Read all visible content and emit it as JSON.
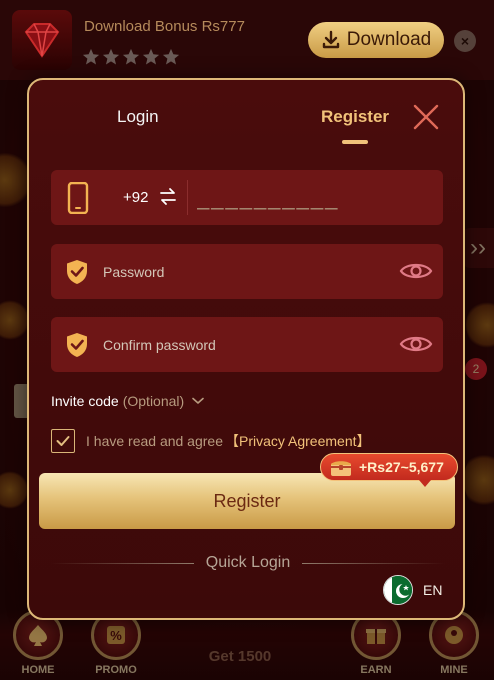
{
  "banner": {
    "title": "Download Bonus Rs777",
    "rating": 5,
    "download_label": "Download",
    "close_label": "×"
  },
  "modal": {
    "tabs": {
      "login": "Login",
      "register": "Register"
    },
    "phone": {
      "country_code": "+92",
      "placeholder": "__________"
    },
    "password": {
      "placeholder": "Password"
    },
    "confirm_password": {
      "placeholder": "Confirm password"
    },
    "invite": {
      "label": "Invite code",
      "optional": "(Optional)"
    },
    "agreement": {
      "checked": true,
      "text": "I have read and agree",
      "link": "【Privacy Agreement】"
    },
    "register_button": "Register",
    "bonus": "+Rs27~5,677",
    "quick_login": "Quick Login",
    "language": "EN"
  },
  "side": {
    "arrow": "››",
    "badge": "2"
  },
  "bottom_nav": {
    "home": "HOME",
    "promo": "PROMO",
    "get": "Get 1500",
    "earn": "EARN",
    "mine": "MINE"
  },
  "colors": {
    "accent_gold": "#f1c27a",
    "modal_bg": "#3c0909",
    "field_bg": "#6e1616",
    "bonus_red": "#d83a26"
  }
}
